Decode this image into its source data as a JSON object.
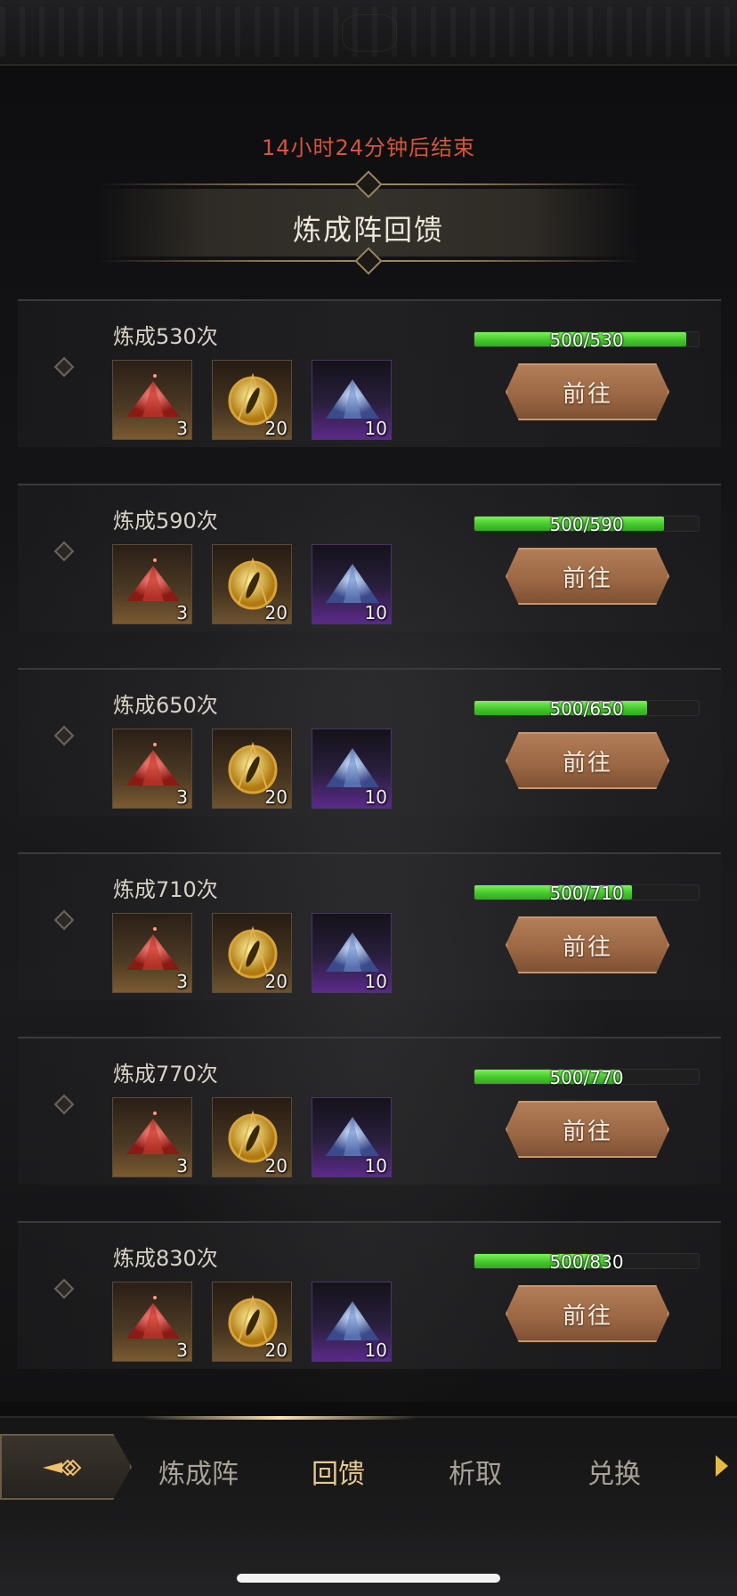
{
  "countdown": "14小时24分钟后结束",
  "banner_title": "炼成阵回馈",
  "rows": [
    {
      "title": "炼成530次",
      "progress_text": "500/530",
      "progress": 0.943,
      "items": [
        {
          "type": "red-crystal",
          "count": "3"
        },
        {
          "type": "gold-eye-medallion",
          "count": "20"
        },
        {
          "type": "purple-crystal",
          "count": "10"
        }
      ],
      "button": "前往"
    },
    {
      "title": "炼成590次",
      "progress_text": "500/590",
      "progress": 0.847,
      "items": [
        {
          "type": "red-crystal",
          "count": "3"
        },
        {
          "type": "gold-eye-medallion",
          "count": "20"
        },
        {
          "type": "purple-crystal",
          "count": "10"
        }
      ],
      "button": "前往"
    },
    {
      "title": "炼成650次",
      "progress_text": "500/650",
      "progress": 0.769,
      "items": [
        {
          "type": "red-crystal",
          "count": "3"
        },
        {
          "type": "gold-eye-medallion",
          "count": "20"
        },
        {
          "type": "purple-crystal",
          "count": "10"
        }
      ],
      "button": "前往"
    },
    {
      "title": "炼成710次",
      "progress_text": "500/710",
      "progress": 0.704,
      "items": [
        {
          "type": "red-crystal",
          "count": "3"
        },
        {
          "type": "gold-eye-medallion",
          "count": "20"
        },
        {
          "type": "purple-crystal",
          "count": "10"
        }
      ],
      "button": "前往"
    },
    {
      "title": "炼成770次",
      "progress_text": "500/770",
      "progress": 0.649,
      "items": [
        {
          "type": "red-crystal",
          "count": "3"
        },
        {
          "type": "gold-eye-medallion",
          "count": "20"
        },
        {
          "type": "purple-crystal",
          "count": "10"
        }
      ],
      "button": "前往"
    },
    {
      "title": "炼成830次",
      "progress_text": "500/830",
      "progress": 0.602,
      "items": [
        {
          "type": "red-crystal",
          "count": "3"
        },
        {
          "type": "gold-eye-medallion",
          "count": "20"
        },
        {
          "type": "purple-crystal",
          "count": "10"
        }
      ],
      "button": "前往"
    }
  ],
  "tabs": [
    {
      "label": "炼成阵",
      "active": false
    },
    {
      "label": "回馈",
      "active": true
    },
    {
      "label": "析取",
      "active": false
    },
    {
      "label": "兑换",
      "active": false
    }
  ],
  "colors": {
    "countdown": "#d6553a",
    "progress_fill": "#45c72d",
    "active_tab": "#e8c98e",
    "button": "#9a6643"
  }
}
